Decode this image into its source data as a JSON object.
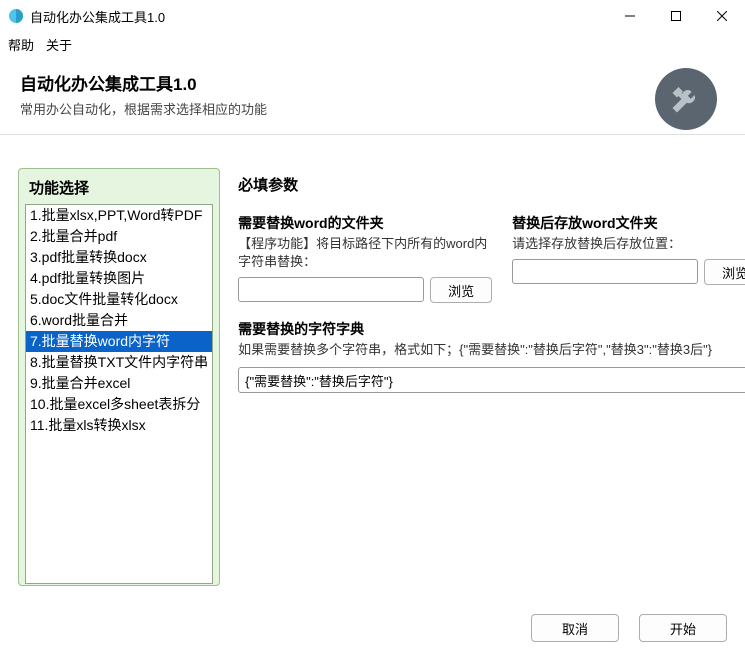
{
  "window": {
    "title": "自动化办公集成工具1.0"
  },
  "menu": {
    "help": "帮助",
    "about": "关于"
  },
  "header": {
    "title": "自动化办公集成工具1.0",
    "subtitle": "常用办公自动化，根据需求选择相应的功能"
  },
  "sidebar": {
    "title": "功能选择",
    "selected_index": 6,
    "items": [
      "1.批量xlsx,PPT,Word转PDF",
      "2.批量合并pdf",
      "3.pdf批量转换docx",
      "4.pdf批量转换图片",
      "5.doc文件批量转化docx",
      "6.word批量合并",
      "7.批量替换word内字符",
      "8.批量替换TXT文件内字符串",
      "9.批量合并excel",
      "10.批量excel多sheet表拆分",
      "11.批量xls转换xlsx"
    ]
  },
  "main": {
    "title": "必填参数",
    "param_left": {
      "label": "需要替换word的文件夹",
      "desc": "【程序功能】将目标路径下内所有的word内字符串替换：",
      "value": "",
      "browse": "浏览"
    },
    "param_right": {
      "label": "替换后存放word文件夹",
      "desc": "请选择存放替换后存放位置：",
      "value": "",
      "browse": "浏览"
    },
    "dict": {
      "label": "需要替换的字符字典",
      "desc": "如果需要替换多个字符串，格式如下；{\"需要替换\":\"替换后字符\",\"替换3\":\"替换3后\"}",
      "value": "{\"需要替换\":\"替换后字符\"}"
    }
  },
  "footer": {
    "cancel": "取消",
    "start": "开始"
  }
}
